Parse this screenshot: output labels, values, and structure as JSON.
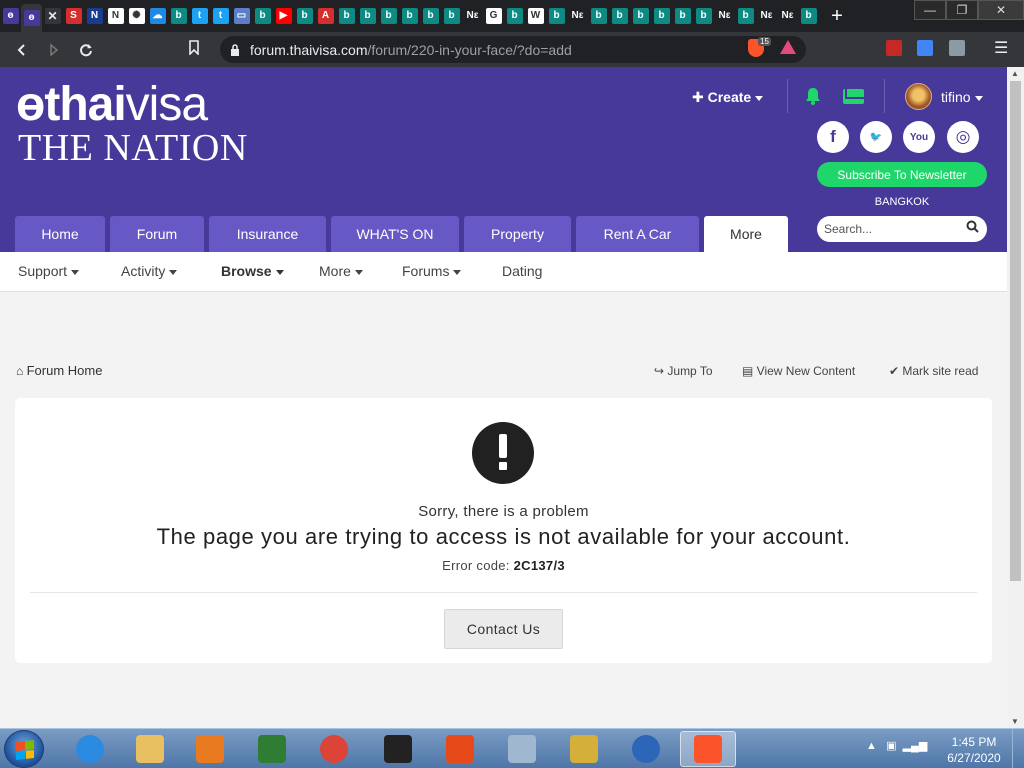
{
  "browser": {
    "tab_favicons": [
      {
        "name": "thaivisa-tab-icon",
        "bg": "#46399a",
        "text": "ɵ"
      },
      {
        "name": "thaivisa-tab-icon",
        "bg": "#46399a",
        "text": "ɵ"
      },
      {
        "name": "close-tab-icon",
        "bg": "#35363a",
        "text": "✕"
      },
      {
        "name": "s-tab-icon",
        "bg": "#d32f2f",
        "text": "S"
      },
      {
        "name": "n-tab-icon",
        "bg": "#1a3c8f",
        "text": "N"
      },
      {
        "name": "n-tab-icon",
        "bg": "#ffffff",
        "text": "N"
      },
      {
        "name": "nbc-tab-icon",
        "bg": "#ffffff",
        "text": "✺"
      },
      {
        "name": "cloud-tab-icon",
        "bg": "#1e88e5",
        "text": "☁"
      },
      {
        "name": "b-tab-icon",
        "bg": "#0f8a82",
        "text": "b"
      },
      {
        "name": "twitter-tab-icon",
        "bg": "#1da1f2",
        "text": "t"
      },
      {
        "name": "twitter-tab-icon",
        "bg": "#1da1f2",
        "text": "t"
      },
      {
        "name": "window-tab-icon",
        "bg": "#5b7fc7",
        "text": "▭"
      },
      {
        "name": "b-tab-icon",
        "bg": "#0f8a82",
        "text": "b"
      },
      {
        "name": "youtube-tab-icon",
        "bg": "#ff0000",
        "text": "▶"
      },
      {
        "name": "b-tab-icon",
        "bg": "#0f8a82",
        "text": "b"
      },
      {
        "name": "a-tab-icon",
        "bg": "#d32f2f",
        "text": "A"
      },
      {
        "name": "b-tab-icon",
        "bg": "#0f8a82",
        "text": "b"
      },
      {
        "name": "b-tab-icon",
        "bg": "#0f8a82",
        "text": "b"
      },
      {
        "name": "b-tab-icon",
        "bg": "#0f8a82",
        "text": "b"
      },
      {
        "name": "b-tab-icon",
        "bg": "#0f8a82",
        "text": "b"
      },
      {
        "name": "b-tab-icon",
        "bg": "#0f8a82",
        "text": "b"
      },
      {
        "name": "b-tab-icon",
        "bg": "#0f8a82",
        "text": "b"
      },
      {
        "name": "news-tab-icon",
        "bg": "#202124",
        "text": "Nε"
      },
      {
        "name": "google-tab-icon",
        "bg": "#ffffff",
        "text": "G"
      },
      {
        "name": "b-tab-icon",
        "bg": "#0f8a82",
        "text": "b"
      },
      {
        "name": "wikipedia-tab-icon",
        "bg": "#ffffff",
        "text": "W"
      },
      {
        "name": "b-tab-icon",
        "bg": "#0f8a82",
        "text": "b"
      },
      {
        "name": "news-tab-icon",
        "bg": "#202124",
        "text": "Nε"
      },
      {
        "name": "b-tab-icon",
        "bg": "#0f8a82",
        "text": "b"
      },
      {
        "name": "b-tab-icon",
        "bg": "#0f8a82",
        "text": "b"
      },
      {
        "name": "b-tab-icon",
        "bg": "#0f8a82",
        "text": "b"
      },
      {
        "name": "b-tab-icon",
        "bg": "#0f8a82",
        "text": "b"
      },
      {
        "name": "b-tab-icon",
        "bg": "#0f8a82",
        "text": "b"
      },
      {
        "name": "b-tab-icon",
        "bg": "#0f8a82",
        "text": "b"
      },
      {
        "name": "news-tab-icon",
        "bg": "#202124",
        "text": "Nε"
      },
      {
        "name": "b-tab-icon",
        "bg": "#0f8a82",
        "text": "b"
      },
      {
        "name": "news-tab-icon",
        "bg": "#202124",
        "text": "Nε"
      },
      {
        "name": "news-tab-icon",
        "bg": "#202124",
        "text": "Nε"
      },
      {
        "name": "b-tab-icon",
        "bg": "#0f8a82",
        "text": "b"
      }
    ],
    "new_tab": "+",
    "url_host": "forum.thaivisa.com",
    "url_path": "/forum/220-in-your-face/?do=add",
    "brave_shield_count": "15",
    "window_controls": {
      "minimize": "—",
      "maximize": "❐",
      "close": "✕"
    }
  },
  "site": {
    "logo_brand_a": "thai",
    "logo_brand_b": "visa",
    "logo_sub": "THE NATION",
    "create_label": "Create",
    "username": "tifino",
    "social": [
      {
        "name": "facebook-icon",
        "glyph": "f"
      },
      {
        "name": "twitter-icon",
        "glyph": "🐦"
      },
      {
        "name": "youtube-icon",
        "glyph": "You"
      },
      {
        "name": "instagram-icon",
        "glyph": "◎"
      }
    ],
    "subscribe_label": "Subscribe To Newsletter",
    "location": "BANGKOK",
    "search_placeholder": "Search...",
    "nav_tabs": [
      "Home",
      "Forum",
      "Insurance",
      "WHAT'S ON",
      "Property",
      "Rent A Car",
      "More"
    ],
    "active_tab": "More",
    "subnav": [
      {
        "label": "Support",
        "caret": true
      },
      {
        "label": "Activity",
        "caret": true
      },
      {
        "label": "Browse",
        "caret": true
      },
      {
        "label": "More",
        "caret": true
      },
      {
        "label": "Forums",
        "caret": true
      },
      {
        "label": "Dating",
        "caret": false
      }
    ],
    "breadcrumb": "Forum Home",
    "actions": {
      "jump_to": "Jump To",
      "view_new": "View New Content",
      "mark_read": "Mark site read"
    },
    "error": {
      "heading": "Sorry, there is a problem",
      "message": "The page you are trying to access is not available for your account.",
      "code_label": "Error code:",
      "code_value": "2C137/3",
      "contact_label": "Contact Us"
    }
  },
  "taskbar": {
    "time": "1:45 PM",
    "date": "6/27/2020",
    "apps": [
      {
        "name": "ie-taskbar-icon",
        "color": "#2b8be0"
      },
      {
        "name": "explorer-taskbar-icon",
        "color": "#e8c062"
      },
      {
        "name": "media-player-taskbar-icon",
        "color": "#e87a1f"
      },
      {
        "name": "notes-taskbar-icon",
        "color": "#2f7d32"
      },
      {
        "name": "chrome-taskbar-icon",
        "color": "#db4437"
      },
      {
        "name": "star-app-taskbar-icon",
        "color": "#222222"
      },
      {
        "name": "office-taskbar-icon",
        "color": "#e64a19"
      },
      {
        "name": "calculator-taskbar-icon",
        "color": "#9fb7cf"
      },
      {
        "name": "search-tool-taskbar-icon",
        "color": "#d4b03a"
      },
      {
        "name": "globe-taskbar-icon",
        "color": "#2b66b8"
      },
      {
        "name": "brave-taskbar-icon",
        "color": "#fb542b"
      }
    ]
  }
}
